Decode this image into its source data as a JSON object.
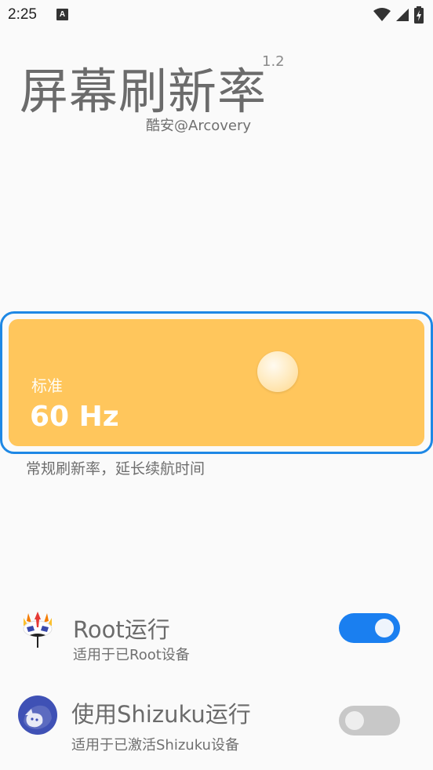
{
  "status_bar": {
    "time": "2:25",
    "notification_icon": "A",
    "icons": [
      "wifi-icon",
      "signal-icon",
      "battery-charging-icon"
    ]
  },
  "app": {
    "title": "屏幕刷新率",
    "version": "1.2",
    "author": "酷安@Arcovery"
  },
  "refresh_mode": {
    "label": "标准",
    "value": "60 Hz",
    "description": "常规刷新率，延长续航时间",
    "card_color": "#ffc65c",
    "border_color": "#1e88e5"
  },
  "options": {
    "root": {
      "title": "Root运行",
      "subtitle": "适用于已Root设备",
      "icon": "magisk-icon",
      "enabled": true
    },
    "shizuku": {
      "title": "使用Shizuku运行",
      "subtitle": "适用于已激活Shizuku设备",
      "icon": "shizuku-icon",
      "enabled": false
    }
  },
  "colors": {
    "accent": "#1a7ff0",
    "toggle_off": "#c8c8c8"
  }
}
